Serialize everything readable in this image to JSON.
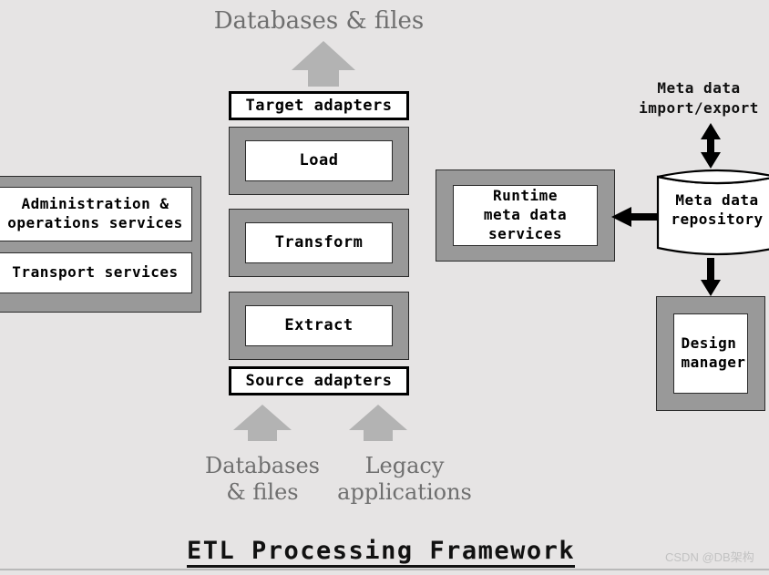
{
  "diagram": {
    "title": "ETL Processing Framework",
    "background_color": "#e6e4e4",
    "frame_color": "#999999",
    "arrow_gray": "#b3b3b3",
    "arrow_black": "#000000"
  },
  "top": {
    "databases_files": "Databases & files"
  },
  "pipeline": {
    "target_adapters": "Target adapters",
    "load": "Load",
    "transform": "Transform",
    "extract": "Extract",
    "source_adapters": "Source adapters"
  },
  "sources": {
    "databases_files": "Databases\n& files",
    "legacy_applications": "Legacy\napplications"
  },
  "left_panel": {
    "administration": "Administration &\noperations services",
    "transport": "Transport services"
  },
  "right": {
    "runtime_services": "Runtime\nmeta data\nservices",
    "meta_data_repository": "Meta data\nrepository",
    "meta_data_import_export": "Meta data\nimport/export",
    "design_manager": "Design\nmanager"
  },
  "watermark": {
    "text": "CSDN @DB架构"
  }
}
